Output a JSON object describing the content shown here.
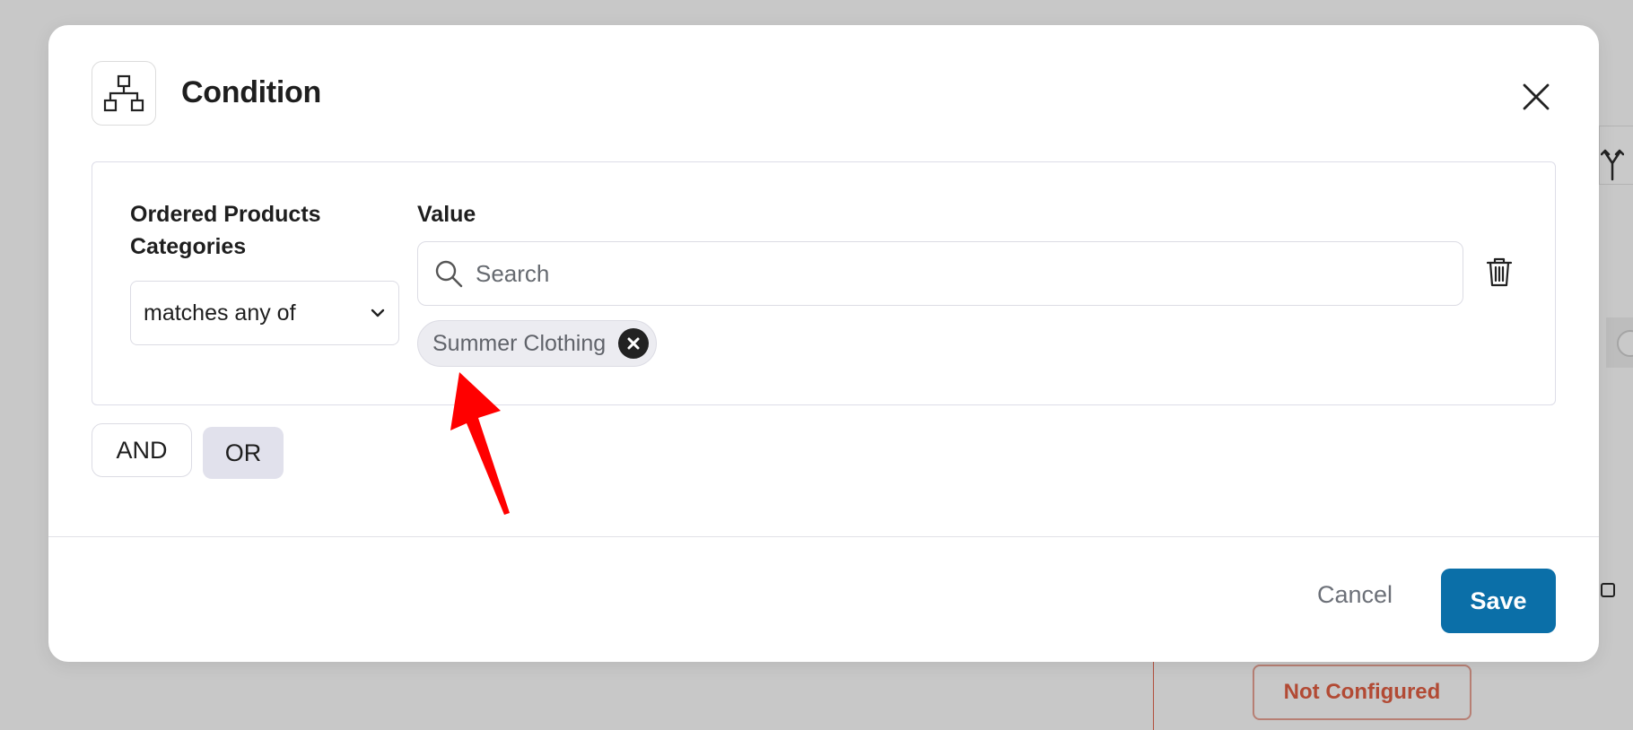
{
  "background": {
    "not_configured_label": "Not Configured",
    "branch_icon": "branch-icon"
  },
  "modal": {
    "title": "Condition",
    "header_icon": "hierarchy-icon",
    "close_icon": "close-icon",
    "condition": {
      "field_label": "Ordered Products Categories",
      "operator_value": "matches any of",
      "value_label": "Value",
      "search_placeholder": "Search",
      "selected_tags": [
        "Summer Clothing"
      ],
      "delete_icon": "trash-icon"
    },
    "logic_buttons": {
      "and_label": "AND",
      "or_label": "OR"
    },
    "footer": {
      "cancel_label": "Cancel",
      "save_label": "Save"
    }
  },
  "colors": {
    "primary": "#0b6fa8",
    "annotation_arrow": "#ff0000",
    "not_configured": "#b24a34"
  }
}
